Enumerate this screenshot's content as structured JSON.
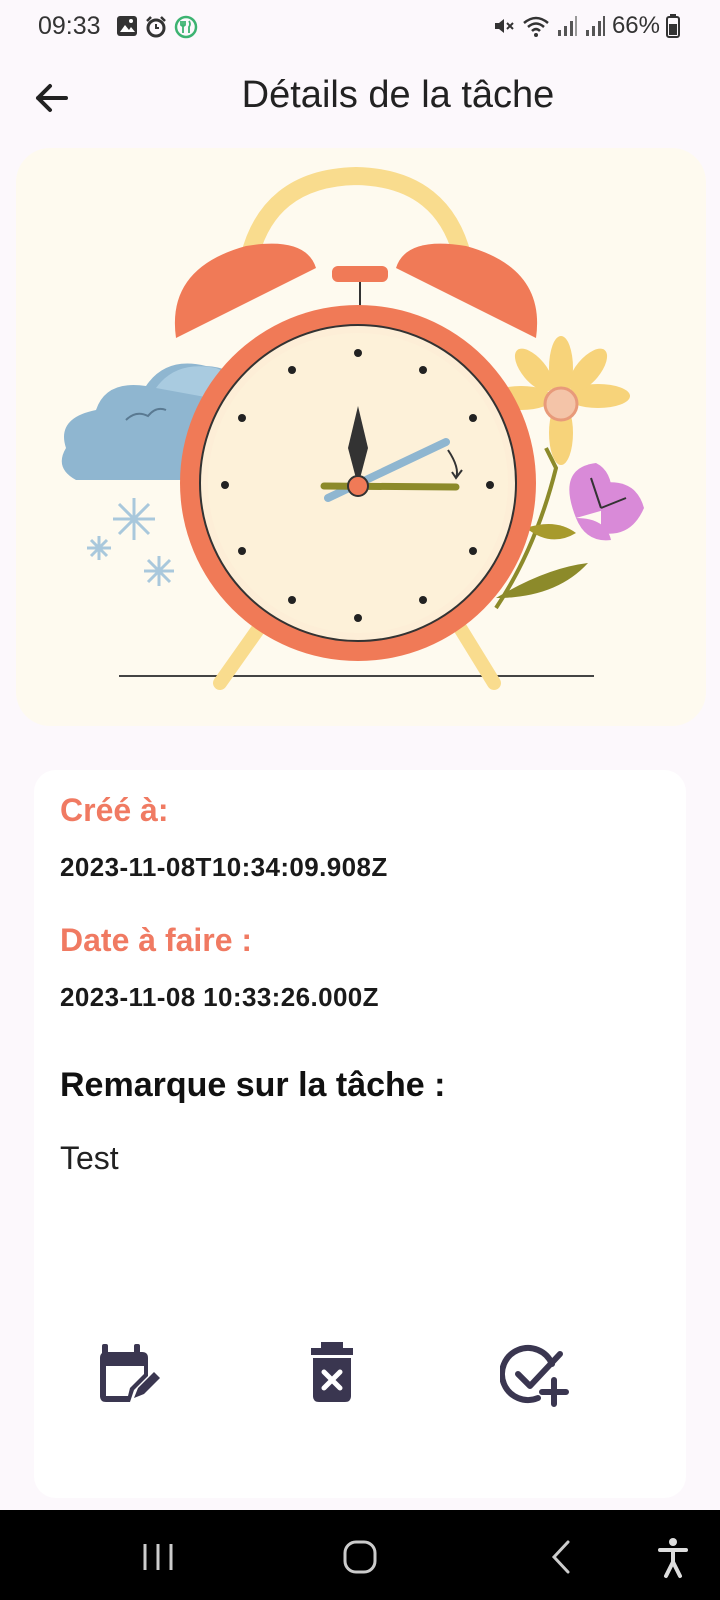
{
  "status_bar": {
    "time": "09:33",
    "battery": "66%",
    "left_icons": [
      "image-icon",
      "alarm-icon",
      "restaurant-icon"
    ],
    "right_icons": [
      "mute-icon",
      "wifi-icon",
      "signal-icon",
      "signal-icon",
      "battery-icon"
    ]
  },
  "app_bar": {
    "title": "Détails de la tâche",
    "back_icon": "arrow-left-icon"
  },
  "task": {
    "created_label": "Créé à:",
    "created_value": "2023-11-08T10:34:09.908Z",
    "due_label": "Date à faire :",
    "due_value": "2023-11-08 10:33:26.000Z",
    "remark_label": "Remarque sur la tâche :",
    "remark_value": "Test"
  },
  "actions": [
    {
      "icon": "calendar-edit-icon"
    },
    {
      "icon": "delete-icon"
    },
    {
      "icon": "check-add-icon"
    }
  ],
  "nav_bar": [
    "recents-icon",
    "home-icon",
    "back-icon",
    "accessibility-icon"
  ],
  "colors": {
    "accent": "#f07a62",
    "icon": "#3a3650",
    "background": "#fcf8fc"
  }
}
